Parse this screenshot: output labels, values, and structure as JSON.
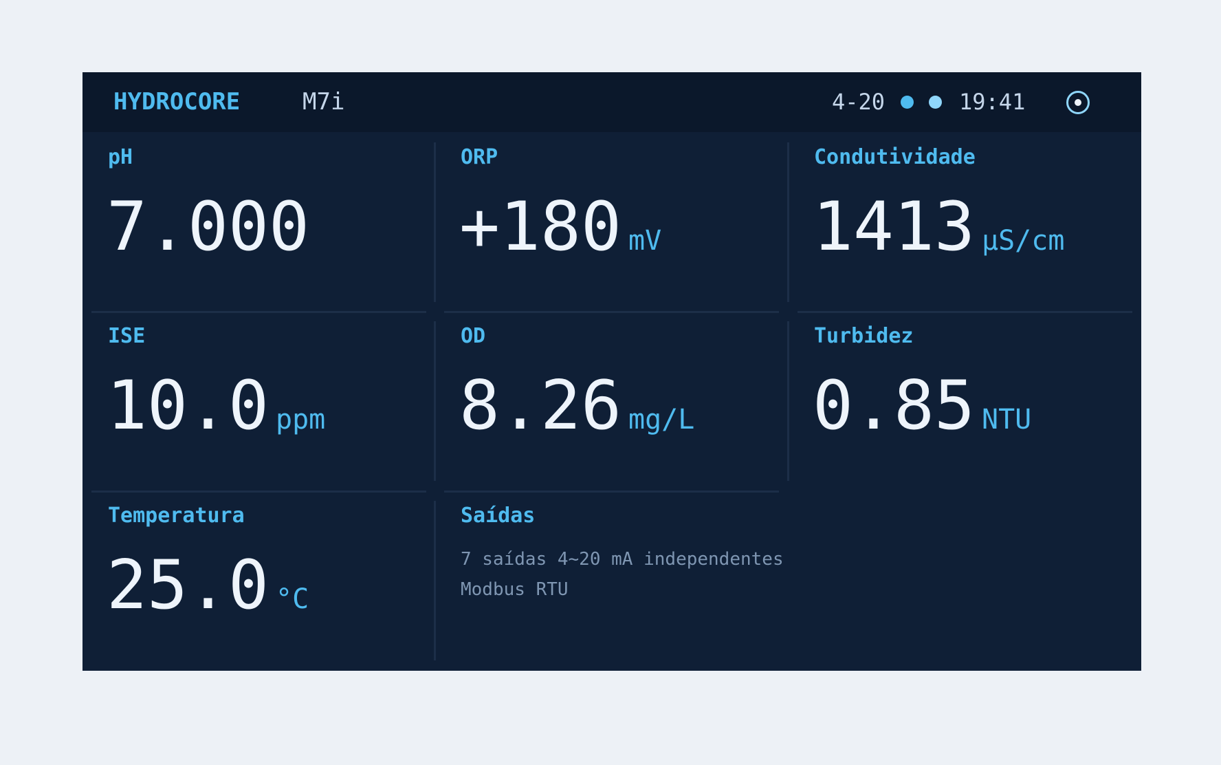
{
  "header": {
    "brand": "HYDROCORE",
    "model": "M7i",
    "loop_label": "4-20",
    "status_dots": [
      {
        "name": "status-dot-1",
        "color": "#4fbbef"
      },
      {
        "name": "status-dot-2",
        "color": "#8fd6fb"
      }
    ],
    "time": "19:41",
    "settings_icon": "target-icon"
  },
  "tiles": [
    {
      "label": "pH",
      "value": "7.000",
      "unit": ""
    },
    {
      "label": "ORP",
      "value": "+180",
      "unit": "mV"
    },
    {
      "label": "Condutividade",
      "value": "1413",
      "unit": "µS/cm"
    },
    {
      "label": "ISE",
      "value": "10.0",
      "unit": "ppm"
    },
    {
      "label": "OD",
      "value": "8.26",
      "unit": "mg/L"
    },
    {
      "label": "Turbidez",
      "value": "0.85",
      "unit": "NTU"
    },
    {
      "label": "Temperatura",
      "value": "25.0",
      "unit": "°C"
    }
  ],
  "outputs": {
    "label": "Saídas",
    "lines": [
      "7 saídas 4~20 mA independentes",
      "Modbus RTU"
    ]
  },
  "colors": {
    "accent": "#4fbbef",
    "panel": "#0f1f36",
    "topbar": "#0b182b",
    "value": "#eef4fb"
  }
}
